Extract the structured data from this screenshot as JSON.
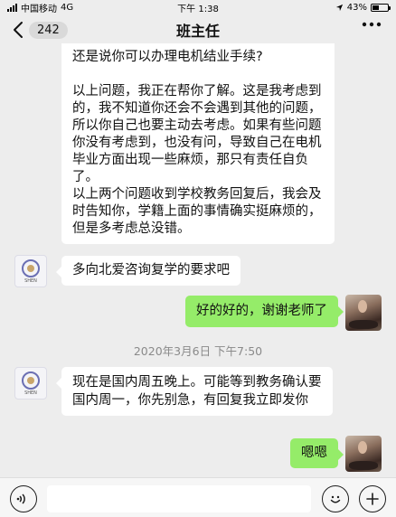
{
  "status_bar": {
    "carrier": "中国移动",
    "network": "4G",
    "time": "下午 1:38",
    "battery": "43%",
    "battery_level": 0.43
  },
  "nav": {
    "back_badge": "242",
    "title": "班主任"
  },
  "messages": [
    {
      "sender": "teacher",
      "text": "还是说你可以办理电机结业手续?\n\n以上问题，我正在帮你了解。这是我考虑到的，我不知道你还会不会遇到其他的问题，所以你自己也要主动去考虑。如果有些问题你没有考虑到，也没有问，导致自己在电机毕业方面出现一些麻烦，那只有责任自负了。\n以上两个问题收到学校教务回复后，我会及时告知你，学籍上面的事情确实挺麻烦的，但是多考虑总没错。"
    },
    {
      "sender": "teacher",
      "text": "多向北爱咨询复学的要求吧"
    },
    {
      "sender": "me",
      "text": "好的好的，谢谢老师了"
    },
    {
      "sender": "teacher",
      "text": "现在是国内周五晚上。可能等到教务确认要国内周一，你先别急，有回复我立即发你"
    },
    {
      "sender": "me",
      "text": "嗯嗯"
    }
  ],
  "timestamp": "2020年3月6日 下午7:50",
  "avatar_label": "SHEN",
  "input": {
    "value": "",
    "placeholder": ""
  },
  "colors": {
    "background": "#ededed",
    "outgoing_bubble": "#95ec69",
    "incoming_bubble": "#ffffff"
  }
}
